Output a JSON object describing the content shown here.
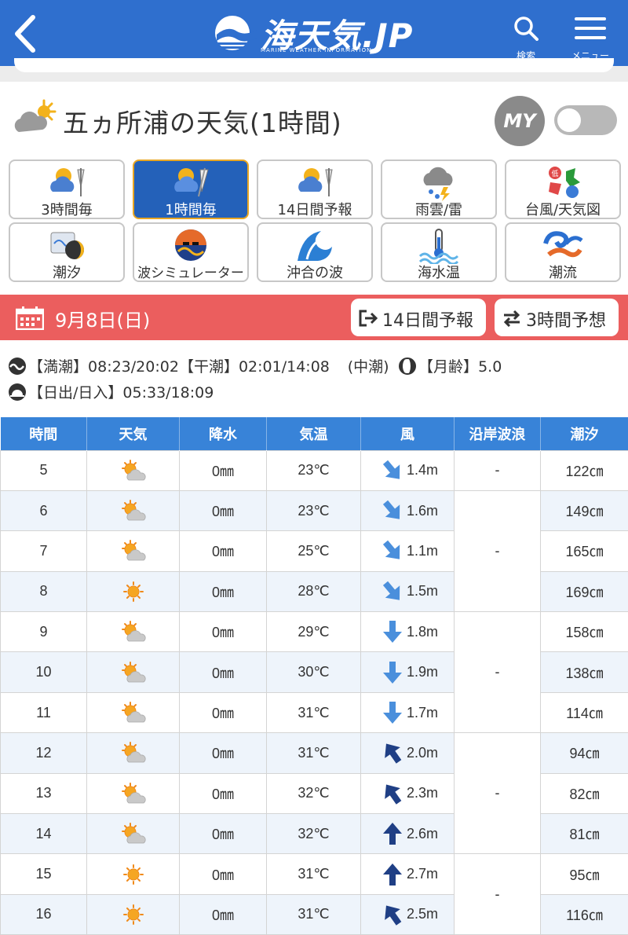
{
  "header": {
    "logo_text": "海天気.JP",
    "logo_sub": "MARINE WEATHER INFORMATION",
    "search_label": "検索",
    "menu_label": "メニュー",
    "colors": {
      "primary": "#2f6fce"
    }
  },
  "title": {
    "text": "五ヵ所浦の天気(1時間)",
    "my_badge": "MY",
    "toggle_on": false
  },
  "nav": [
    {
      "label": "3時間毎",
      "icon": "weather-3h-icon",
      "active": false
    },
    {
      "label": "1時間毎",
      "icon": "weather-1h-icon",
      "active": true
    },
    {
      "label": "14日間予報",
      "icon": "weather-14d-icon",
      "active": false
    },
    {
      "label": "雨雲/雷",
      "icon": "rain-thunder-icon",
      "active": false
    },
    {
      "label": "台風/天気図",
      "icon": "typhoon-map-icon",
      "active": false
    },
    {
      "label": "潮汐",
      "icon": "tide-icon",
      "active": false
    },
    {
      "label": "波シミュレーター",
      "icon": "wave-simulator-icon",
      "active": false
    },
    {
      "label": "沖合の波",
      "icon": "offshore-wave-icon",
      "active": false
    },
    {
      "label": "海水温",
      "icon": "sea-temp-icon",
      "active": false
    },
    {
      "label": "潮流",
      "icon": "current-icon",
      "active": false
    }
  ],
  "datebar": {
    "date": "9月8日(日)",
    "btn_14d": "14日間予報",
    "btn_3h": "3時間予想",
    "color": "#eb5e5e"
  },
  "info": {
    "high_label": "【満潮】",
    "high_value": "08:23/20:02",
    "low_label": "【干潮】",
    "low_value": "02:01/14:08",
    "tide_type": "(中潮)",
    "moon_label": "【月齢】",
    "moon_value": "5.0",
    "sun_label": "【日出/日入】",
    "sun_value": "05:33/18:09"
  },
  "table": {
    "headers": [
      "時間",
      "天気",
      "降水",
      "気温",
      "風",
      "沿岸波浪",
      "潮汐"
    ],
    "rows": [
      {
        "hour": "5",
        "weather": "sun-cloud",
        "precip": "0㎜",
        "temp": "23℃",
        "wind_dir": "SW",
        "wind": "1.4m",
        "tide": "122㎝"
      },
      {
        "hour": "6",
        "weather": "sun-cloud",
        "precip": "0㎜",
        "temp": "23℃",
        "wind_dir": "SW",
        "wind": "1.6m",
        "tide": "149㎝"
      },
      {
        "hour": "7",
        "weather": "sun-cloud",
        "precip": "0㎜",
        "temp": "25℃",
        "wind_dir": "SW",
        "wind": "1.1m",
        "tide": "165㎝"
      },
      {
        "hour": "8",
        "weather": "sun",
        "precip": "0㎜",
        "temp": "28℃",
        "wind_dir": "SW",
        "wind": "1.5m",
        "tide": "169㎝"
      },
      {
        "hour": "9",
        "weather": "sun-cloud",
        "precip": "0㎜",
        "temp": "29℃",
        "wind_dir": "S",
        "wind": "1.8m",
        "tide": "158㎝"
      },
      {
        "hour": "10",
        "weather": "sun-cloud",
        "precip": "0㎜",
        "temp": "30℃",
        "wind_dir": "S",
        "wind": "1.9m",
        "tide": "138㎝"
      },
      {
        "hour": "11",
        "weather": "sun-cloud",
        "precip": "0㎜",
        "temp": "31℃",
        "wind_dir": "S",
        "wind": "1.7m",
        "tide": "114㎝"
      },
      {
        "hour": "12",
        "weather": "sun-cloud",
        "precip": "0㎜",
        "temp": "31℃",
        "wind_dir": "NE",
        "wind": "2.0m",
        "tide": "94㎝"
      },
      {
        "hour": "13",
        "weather": "sun-cloud",
        "precip": "0㎜",
        "temp": "32℃",
        "wind_dir": "NE",
        "wind": "2.3m",
        "tide": "82㎝"
      },
      {
        "hour": "14",
        "weather": "sun-cloud",
        "precip": "0㎜",
        "temp": "32℃",
        "wind_dir": "N",
        "wind": "2.6m",
        "tide": "81㎝"
      },
      {
        "hour": "15",
        "weather": "sun",
        "precip": "0㎜",
        "temp": "31℃",
        "wind_dir": "N",
        "wind": "2.7m",
        "tide": "95㎝"
      },
      {
        "hour": "16",
        "weather": "sun",
        "precip": "0㎜",
        "temp": "31℃",
        "wind_dir": "NE",
        "wind": "2.5m",
        "tide": "116㎝"
      }
    ],
    "wave_groups": [
      {
        "value": "-",
        "span": 1
      },
      {
        "value": "-",
        "span": 3
      },
      {
        "value": "-",
        "span": 3
      },
      {
        "value": "-",
        "span": 3
      },
      {
        "value": "-",
        "span": 2
      }
    ]
  }
}
